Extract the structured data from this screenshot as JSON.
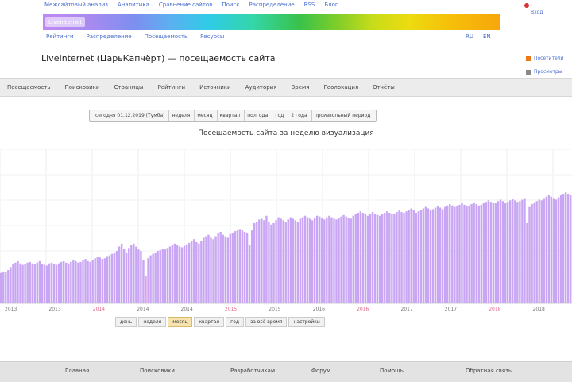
{
  "top_links": [
    "Межсайтовый анализ",
    "Аналитика",
    "Сравнение сайтов",
    "Поиск",
    "Распределение",
    "RSS",
    "Блог"
  ],
  "corner": {
    "link": "Вход"
  },
  "rainbow": {
    "label": "LiveInternet"
  },
  "sub_links": [
    "Рейтинги",
    "Распределение",
    "Посещаемость",
    "Ресурсы"
  ],
  "sub_links_right": [
    "RU",
    "EN"
  ],
  "page_title": "LiveInternet (ЦарьКапчёрт) — посещаемость сайта",
  "legend_right": [
    {
      "label": "Посетители",
      "color": "#e87a1a"
    },
    {
      "label": "Просмотры",
      "color": "#888888"
    }
  ],
  "tabs": [
    "Посещаемость",
    "Поисковики",
    "Страницы",
    "Рейтинги",
    "Источники",
    "Аудитория",
    "Время",
    "Геолокация",
    "Отчёты"
  ],
  "range_options": [
    "сегодня 01.12.2019 (Тумба)",
    "неделя",
    "месяц",
    "квартал",
    "полгода",
    "год",
    "2 года",
    "произвольный период"
  ],
  "chart_title": "Посещаемость сайта за неделю визуализация",
  "periods": [
    "день",
    "неделя",
    "месяц",
    "квартал",
    "год",
    "за всё время",
    "настройки"
  ],
  "active_period_index": 2,
  "footer_links": [
    "Главная",
    "Поисковики",
    "Разработчикам",
    "Форум",
    "Помощь",
    "Обратная связь"
  ],
  "chart_data": {
    "type": "bar",
    "bar_color": "#c9a6f3",
    "highlight_color": "#e59ee8",
    "grid": true,
    "xlabels": [
      "2013",
      "2013",
      "2014",
      "2014",
      "2014",
      "2015",
      "2015",
      "2016",
      "2016",
      "2017",
      "2017",
      "2018",
      "2018"
    ],
    "ylim": [
      0,
      100
    ],
    "values": [
      22,
      24,
      23,
      26,
      30,
      34,
      36,
      38,
      35,
      33,
      34,
      36,
      37,
      35,
      34,
      36,
      38,
      34,
      33,
      32,
      35,
      36,
      34,
      33,
      35,
      37,
      38,
      36,
      35,
      37,
      39,
      38,
      36,
      37,
      40,
      41,
      38,
      37,
      40,
      42,
      44,
      43,
      41,
      42,
      45,
      46,
      48,
      50,
      52,
      58,
      62,
      55,
      50,
      56,
      60,
      62,
      58,
      54,
      52,
      40,
      18,
      42,
      46,
      48,
      50,
      52,
      53,
      55,
      54,
      56,
      58,
      60,
      62,
      60,
      58,
      57,
      59,
      61,
      63,
      65,
      68,
      64,
      62,
      66,
      70,
      72,
      74,
      70,
      68,
      72,
      76,
      78,
      74,
      72,
      70,
      75,
      77,
      79,
      80,
      82,
      80,
      78,
      76,
      60,
      80,
      90,
      92,
      95,
      96,
      94,
      100,
      92,
      88,
      90,
      94,
      98,
      96,
      94,
      92,
      95,
      98,
      96,
      94,
      92,
      96,
      98,
      100,
      98,
      96,
      94,
      97,
      100,
      99,
      97,
      95,
      98,
      100,
      98,
      96,
      95,
      97,
      99,
      101,
      99,
      97,
      96,
      100,
      102,
      104,
      106,
      104,
      102,
      100,
      103,
      105,
      103,
      101,
      100,
      102,
      104,
      106,
      104,
      102,
      103,
      105,
      107,
      105,
      104,
      106,
      108,
      110,
      108,
      104,
      106,
      108,
      110,
      112,
      110,
      108,
      109,
      111,
      113,
      111,
      109,
      112,
      114,
      116,
      114,
      112,
      113,
      115,
      117,
      115,
      113,
      114,
      116,
      118,
      116,
      114,
      115,
      117,
      119,
      121,
      119,
      117,
      118,
      120,
      122,
      120,
      118,
      119,
      121,
      123,
      121,
      119,
      120,
      122,
      124,
      90,
      112,
      116,
      118,
      120,
      122,
      121,
      124,
      126,
      128,
      126,
      124,
      122,
      125,
      128,
      130,
      132,
      130,
      128
    ]
  }
}
